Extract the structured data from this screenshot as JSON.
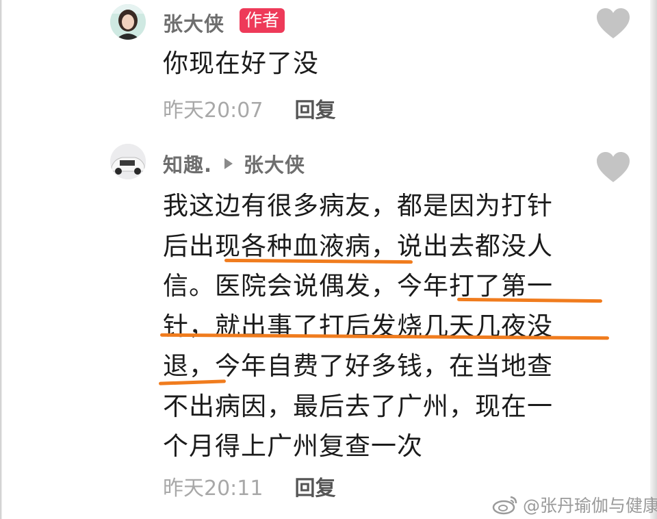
{
  "comments": [
    {
      "username": "张大侠",
      "badge": "作者",
      "text": "你现在好了没",
      "time": "昨天20:07",
      "reply": "回复"
    },
    {
      "username": "知趣.",
      "reply_to": "张大侠",
      "lines": [
        "我这边有很多病友，都是因为打针",
        "后出现各种血液病，说出去都没人",
        "信。医院会说偶发，今年打了第一",
        "针，就出事了打后发烧几天几夜没",
        "退，今年自费了好多钱，在当地查",
        "不出病因，最后去了广州，现在一",
        "个月得上广州复查一次"
      ],
      "time": "昨天20:11",
      "reply": "回复"
    }
  ],
  "watermark": "@张丹瑜伽与健康",
  "colors": {
    "author_badge": "#ee3a59",
    "underline": "#f07c1e",
    "heart": "#c4c4c4"
  },
  "icons": [
    "heart-icon",
    "reply-arrow-icon",
    "weibo-icon"
  ]
}
